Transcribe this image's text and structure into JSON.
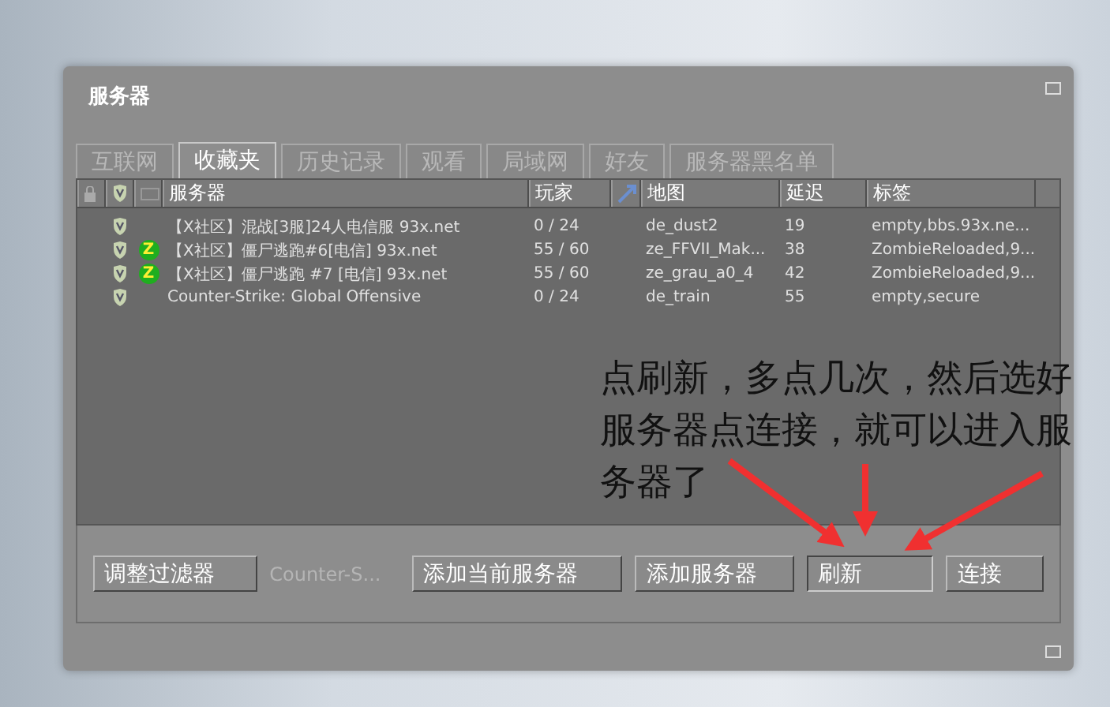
{
  "window": {
    "title": "服务器"
  },
  "tabs": [
    {
      "label": "互联网",
      "selected": false
    },
    {
      "label": "收藏夹",
      "selected": true
    },
    {
      "label": "历史记录",
      "selected": false
    },
    {
      "label": "观看",
      "selected": false
    },
    {
      "label": "局域网",
      "selected": false
    },
    {
      "label": "好友",
      "selected": false
    },
    {
      "label": "服务器黑名单",
      "selected": false
    }
  ],
  "table": {
    "columns": [
      "服务器",
      "玩家",
      "地图",
      "延迟",
      "标签"
    ],
    "rows": [
      {
        "secure": true,
        "badge": "",
        "server": "【X社区】混战[3服]24人电信服 93x.net",
        "players": "0 / 24",
        "map": "de_dust2",
        "latency": "19",
        "tags": "empty,bbs.93x.ne..."
      },
      {
        "secure": true,
        "badge": "Z",
        "server": "【X社区】僵尸逃跑#6[电信] 93x.net",
        "players": "55 / 60",
        "map": "ze_FFVII_Mak...",
        "latency": "38",
        "tags": "ZombieReloaded,9..."
      },
      {
        "secure": true,
        "badge": "Z",
        "server": "【X社区】僵尸逃跑 #7 [电信] 93x.net",
        "players": "55 / 60",
        "map": "ze_grau_a0_4",
        "latency": "42",
        "tags": "ZombieReloaded,9..."
      },
      {
        "secure": true,
        "badge": "",
        "server": "Counter-Strike: Global Offensive",
        "players": "0 / 24",
        "map": "de_train",
        "latency": "55",
        "tags": "empty,secure"
      }
    ]
  },
  "footer": {
    "filter_button": "调整过滤器",
    "game_label": "Counter-S...",
    "buttons": [
      {
        "label": "添加当前服务器",
        "focused": false
      },
      {
        "label": "添加服务器",
        "focused": false
      },
      {
        "label": "刷新",
        "focused": true
      },
      {
        "label": "连接",
        "focused": false
      }
    ]
  },
  "annotation": {
    "lines": [
      "点刷新，多点几次，然后选好",
      "服务器点连接，就可以进入服",
      "务器了"
    ]
  }
}
